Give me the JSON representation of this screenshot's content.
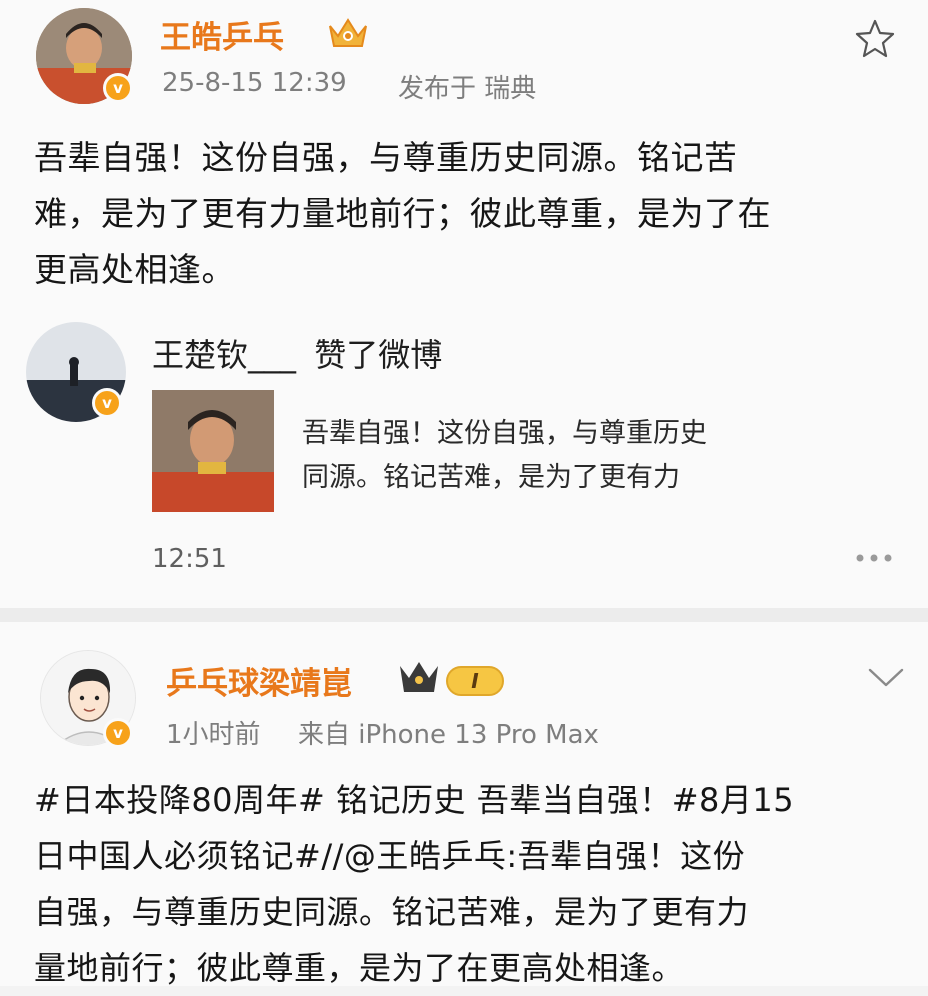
{
  "post1": {
    "author": "王皓乒乓",
    "time": "25-8-15 12:39",
    "location": "发布于 瑞典",
    "lines": [
      "吾辈自强！这份自强，与尊重历史同源。铭记苦",
      "难，是为了更有力量地前行；彼此尊重，是为了在",
      "更高处相逢。"
    ],
    "icons": {
      "crown": "crown-badge-icon",
      "star": "star-icon",
      "verified": "verified-v-icon"
    }
  },
  "like_activity": {
    "user": "王楚钦___",
    "action": "赞了微博",
    "preview_lines": [
      "吾辈自强！这份自强，与尊重历史",
      "同源。铭记苦难，是为了更有力"
    ],
    "time": "12:51",
    "more": "more-icon"
  },
  "post2": {
    "author": "乒乓球梁靖崑",
    "level": "I",
    "time": "1小时前",
    "source": "来自 iPhone 13 Pro Max",
    "lines": [
      "#日本投降80周年# 铭记历史 吾辈当自强！#8月15",
      "日中国人必须铭记#//@王皓乒乓:吾辈自强！这份",
      "自强，与尊重历史同源。铭记苦难，是为了更有力",
      "量地前行；彼此尊重，是为了在更高处相逢。"
    ],
    "icons": {
      "crown": "crown-icon",
      "chevron": "chevron-down-icon"
    }
  },
  "colors": {
    "accent": "#e8781b",
    "verified": "#f7a21a",
    "meta": "#7e7e7e"
  }
}
